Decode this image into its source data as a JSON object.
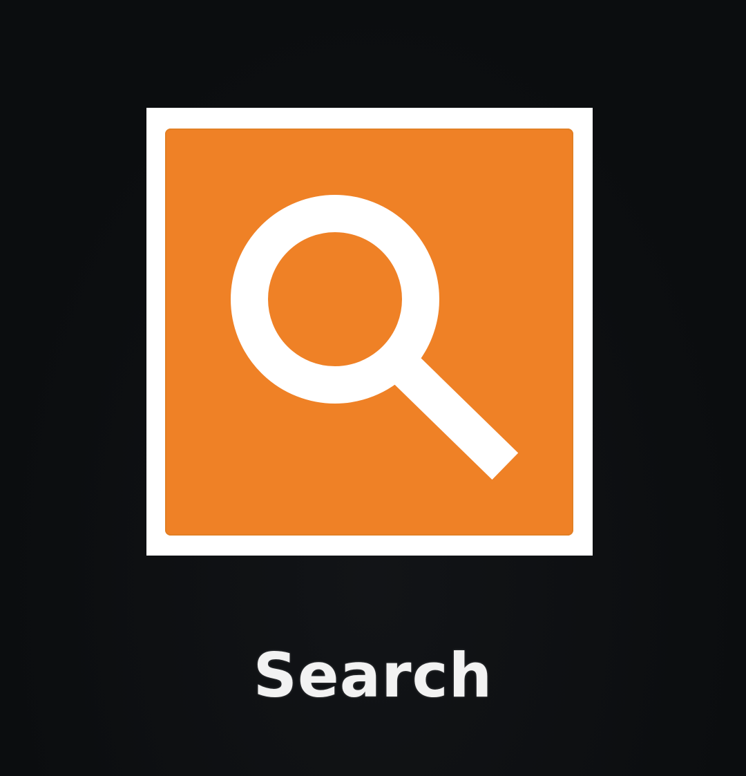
{
  "launcher": {
    "app": {
      "label": "Search",
      "icon": "search-icon",
      "tile_color": "#ffffff",
      "icon_background_color": "#ef8126",
      "glyph_color": "#ffffff"
    }
  },
  "colors": {
    "background": "#0b0d0f",
    "label_text": "#f2f2f2"
  }
}
